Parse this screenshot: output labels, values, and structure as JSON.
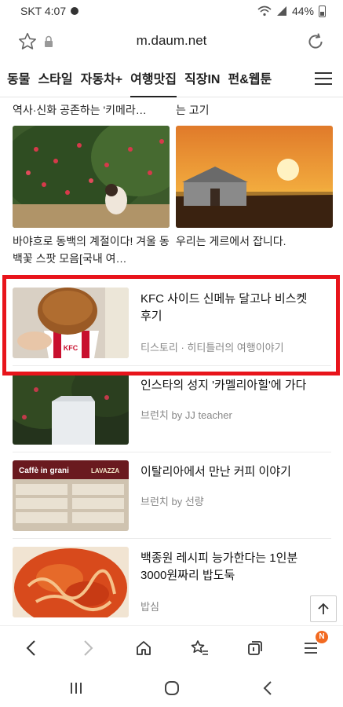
{
  "status_bar": {
    "carrier_time": "SKT 4:07",
    "battery": "44%"
  },
  "browser": {
    "url": "m.daum.net"
  },
  "categories": [
    {
      "label": "동물"
    },
    {
      "label": "스타일"
    },
    {
      "label": "자동차+"
    },
    {
      "label": "여행맛집"
    },
    {
      "label": "직장IN"
    },
    {
      "label": "펀&웹툰"
    }
  ],
  "active_category": "여행맛집",
  "cut_titles": {
    "left": "역사·신화 공존하는 '키메라…",
    "right": "는 고기"
  },
  "grid_cards": [
    {
      "title": "바야흐로 동백의 계절이다! 겨울 동백꽃 스팟 모음[국내 여…"
    },
    {
      "title": "우리는 게르에서 잡니다."
    }
  ],
  "list_items": [
    {
      "title": "KFC 사이드 신메뉴 달고나 비스켓 후기",
      "source": "티스토리 · 히티틀러의 여행이야기"
    },
    {
      "title": "인스타의 성지 '카멜리아힐'에 가다",
      "source": "브런치 by JJ teacher"
    },
    {
      "title": "이탈리아에서 만난 커피 이야기",
      "source": "브런치 by 선량"
    },
    {
      "title": "백종원 레시피 능가한다는 1인분 3000원짜리 밥도둑",
      "source": "밥심"
    }
  ],
  "thumb_labels": {
    "kfc": "KFC",
    "cafe": "Caffè in grani",
    "lavazza": "LAVAZZA"
  },
  "bottom_badge": "N",
  "colors": {
    "highlight": "#e8141b",
    "badge": "#f26a21"
  }
}
